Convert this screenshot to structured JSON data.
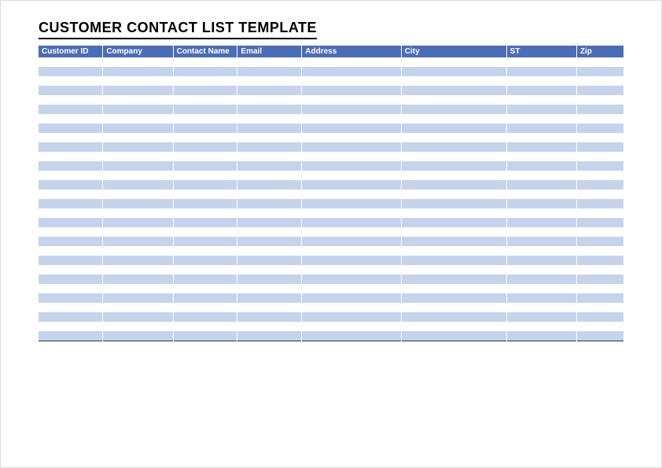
{
  "title": "CUSTOMER CONTACT LIST TEMPLATE",
  "columns": {
    "customer_id": "Customer ID",
    "company": "Company",
    "contact_name": "Contact Name",
    "email": "Email",
    "address": "Address",
    "city": "City",
    "st": "ST",
    "zip": "Zip"
  },
  "row_count": 30
}
